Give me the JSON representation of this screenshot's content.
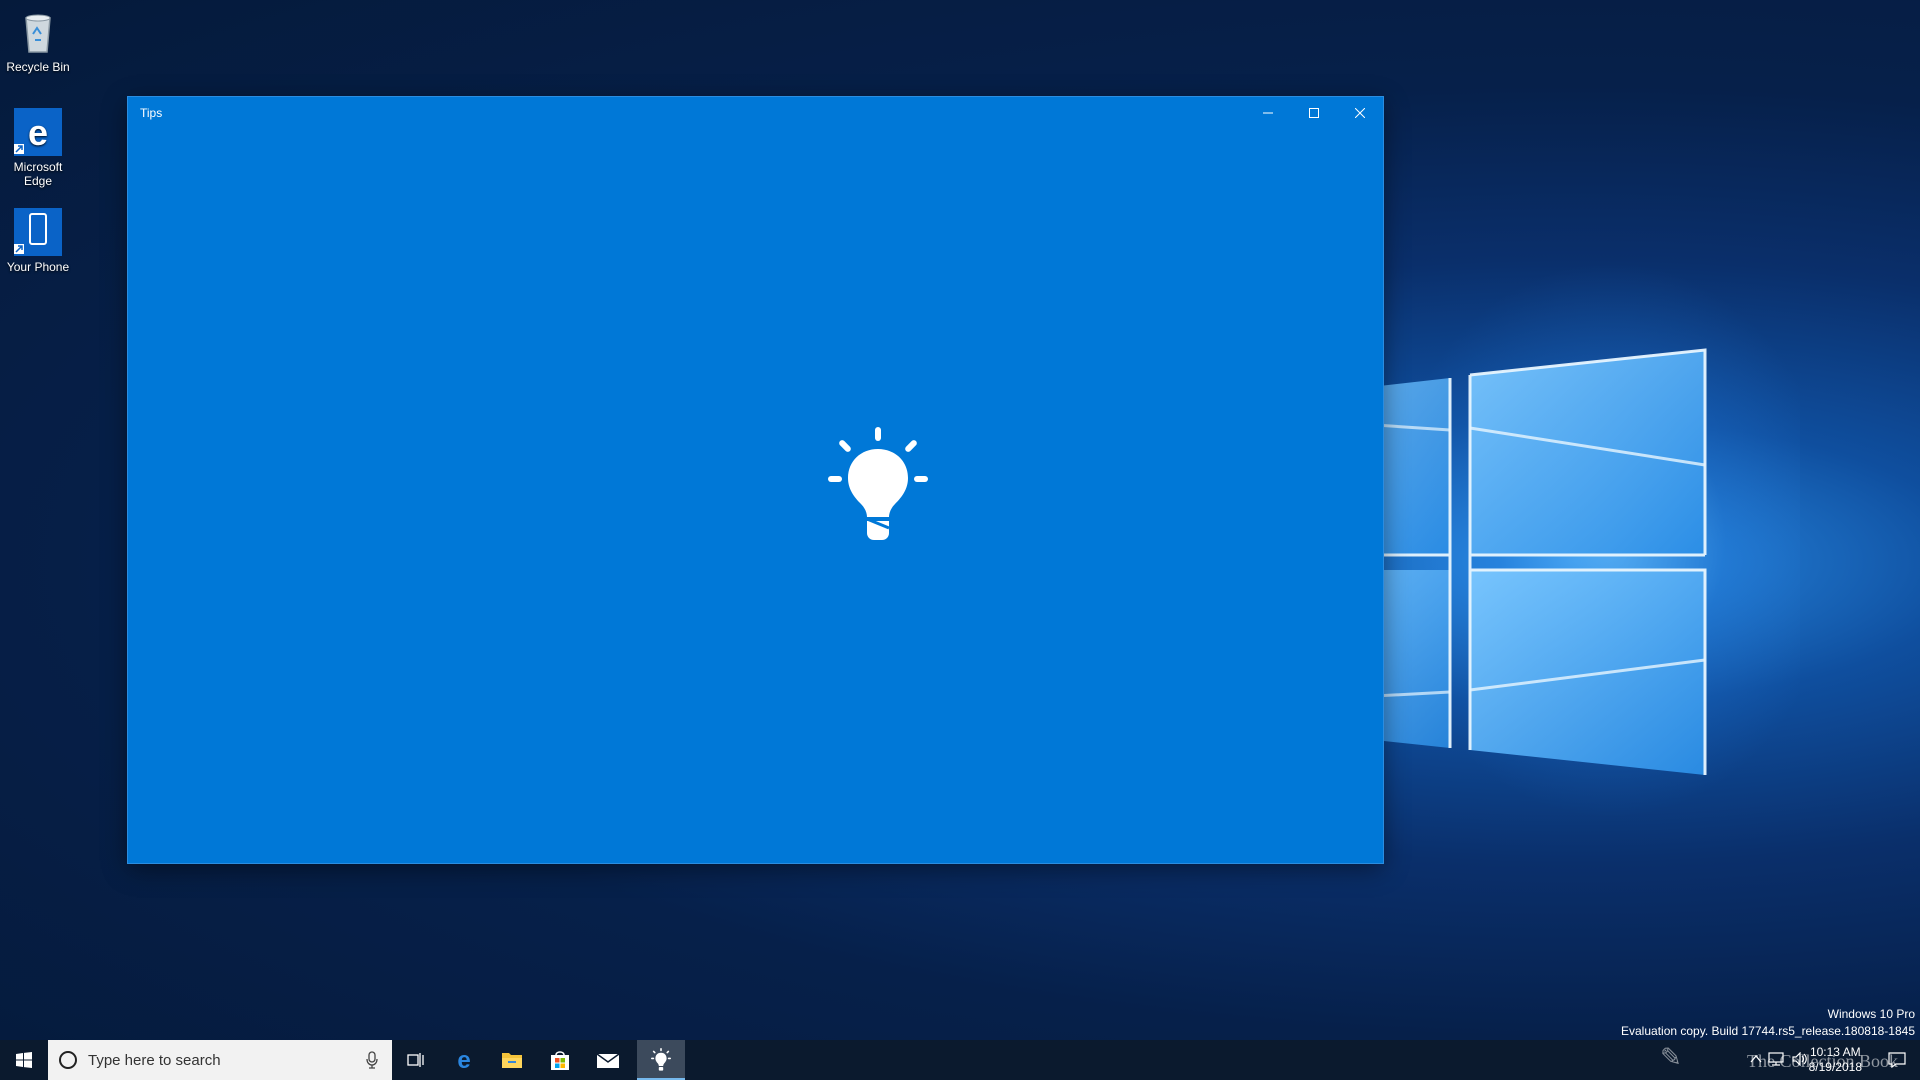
{
  "desktop": {
    "icons": [
      {
        "label": "Recycle Bin"
      },
      {
        "label_line1": "Microsoft",
        "label_line2": "Edge"
      },
      {
        "label": "Your Phone"
      }
    ]
  },
  "window": {
    "title": "Tips",
    "background_color": "#0078d7",
    "center_icon": "lightbulb-icon"
  },
  "taskbar": {
    "search_placeholder": "Type here to search",
    "pinned": [
      "windows-start-icon",
      "task-view-icon",
      "edge-icon",
      "file-explorer-icon",
      "store-icon",
      "mail-icon",
      "tips-icon"
    ],
    "active_app": "tips-icon"
  },
  "watermark": {
    "line1": "Windows 10 Pro",
    "line2": "Evaluation copy. Build 17744.rs5_release.180818-1845"
  },
  "clock": {
    "time": "10:13 AM",
    "date": "8/19/2018"
  },
  "overlay_text": "The Collection Book"
}
